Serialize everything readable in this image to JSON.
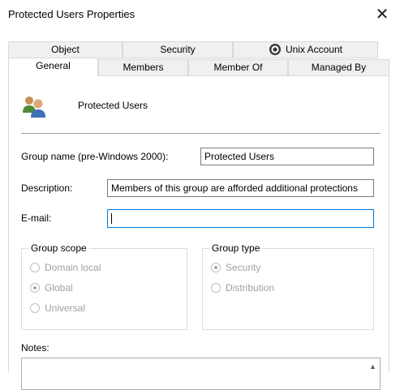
{
  "window": {
    "title": "Protected Users Properties",
    "close_glyph": "✕"
  },
  "tabs_row1": [
    {
      "label": "Object"
    },
    {
      "label": "Security"
    },
    {
      "label": "Unix Account",
      "icon": "unix-account-icon"
    }
  ],
  "tabs_row2": [
    {
      "label": "General",
      "selected": true
    },
    {
      "label": "Members"
    },
    {
      "label": "Member Of"
    },
    {
      "label": "Managed By"
    }
  ],
  "header": {
    "group_name": "Protected Users",
    "icon": "users-group-icon"
  },
  "fields": {
    "group_name_label": "Group name (pre-Windows 2000):",
    "group_name_value": "Protected Users",
    "description_label": "Description:",
    "description_value": "Members of this group are afforded additional protections",
    "email_label": "E-mail:",
    "email_value": ""
  },
  "group_scope": {
    "legend": "Group scope",
    "options": [
      "Domain local",
      "Global",
      "Universal"
    ],
    "selected": "Global"
  },
  "group_type": {
    "legend": "Group type",
    "options": [
      "Security",
      "Distribution"
    ],
    "selected": "Security"
  },
  "notes": {
    "label": "Notes:",
    "scroll_glyph": "▲"
  },
  "colors": {
    "focus_border": "#0078d7",
    "disabled_text": "#a0a0a0",
    "tab_background": "#f0f0f0"
  }
}
